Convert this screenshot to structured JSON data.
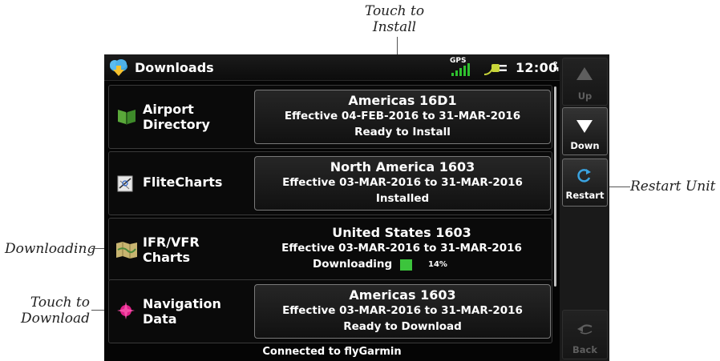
{
  "screen": {
    "title": "Downloads",
    "status_indicator": "GPS",
    "time": "12:00",
    "time_suffix_top": "P",
    "time_suffix_bottom": "M",
    "rows": [
      {
        "label": "Airport\nDirectory",
        "icon": "book-icon",
        "line1": "Americas 16D1",
        "line2": "Effective 04-FEB-2016 to 31-MAR-2016",
        "line3": "Ready to Install"
      },
      {
        "label": "FliteCharts",
        "icon": "chart-icon",
        "line1": "North America 1603",
        "line2": "Effective 03-MAR-2016 to 31-MAR-2016",
        "line3": "Installed"
      },
      {
        "label": "IFR/VFR\nCharts",
        "icon": "map-icon",
        "line1": "United States 1603",
        "line2": "Effective 03-MAR-2016 to 31-MAR-2016",
        "line3": "Downloading",
        "progress_text": "14%",
        "progress": 0.14
      },
      {
        "label": "Navigation\nData",
        "icon": "compass-rose-icon",
        "line1": "Americas 1603",
        "line2": "Effective 03-MAR-2016 to 31-MAR-2016",
        "line3": "Ready to Download"
      }
    ],
    "status_bar": "Connected to flyGarmin"
  },
  "sidebar": {
    "up_label": "Up",
    "down_label": "Down",
    "restart_label": "Restart",
    "back_label": "Back"
  },
  "callouts": {
    "touch_to_install": "Touch to\nInstall",
    "restart_unit": "Restart Unit",
    "downloading": "Downloading",
    "touch_to_download": "Touch to\nDownload"
  },
  "colors": {
    "progress": "#3cc43c",
    "gps_bars": "#2fc12f",
    "plug_icon": "#c9d63a",
    "nav_icon": "#e0208a",
    "cloud_icon": "#3aa3e0",
    "book_icon": "#5aa83a"
  }
}
